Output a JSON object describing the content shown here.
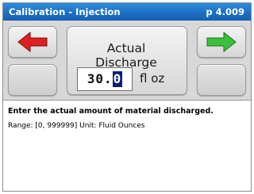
{
  "header": {
    "title": "Calibration - Injection",
    "page_number": "p 4.009"
  },
  "panel": {
    "heading": "Actual Discharge",
    "value_prefix": "30.",
    "value_cursor_digit": "0",
    "unit": "fl oz",
    "prev_button_icon": "left-arrow-icon",
    "next_button_icon": "right-arrow-icon",
    "colors": {
      "prev_arrow": "#e02020",
      "next_arrow": "#3cc03c",
      "title_bar": "#1f74c8",
      "cursor_highlight": "#0a1f7a"
    }
  },
  "info": {
    "instruction": "Enter the actual amount of material discharged.",
    "range_text": "Range: [0, 999999]  Unit: Fluid Ounces"
  }
}
